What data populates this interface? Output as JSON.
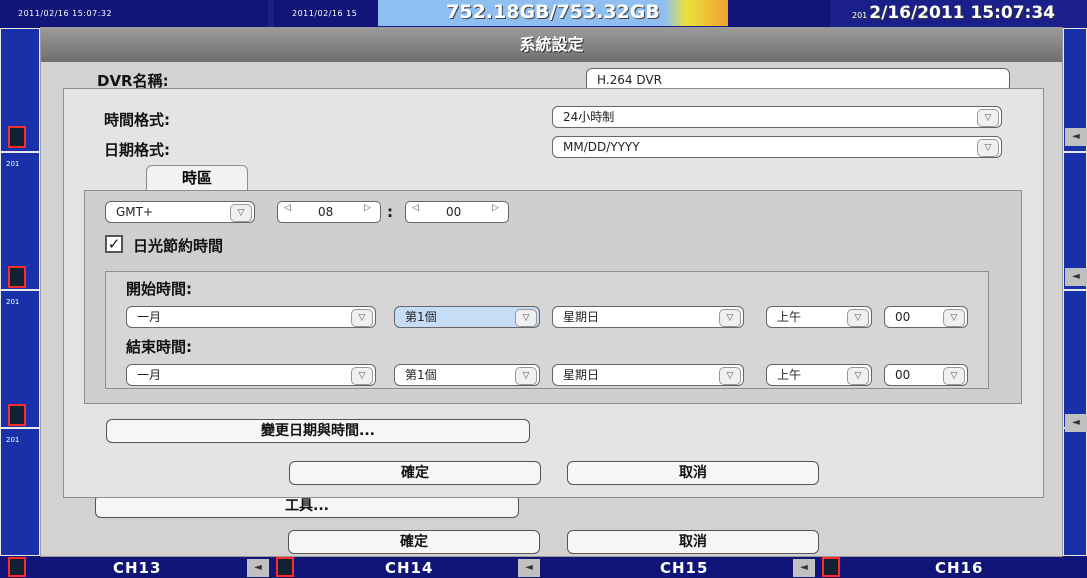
{
  "top_bar": {
    "cam1_time": "2011/02/16 15:07:32",
    "cam2_time": "2011/02/16 15",
    "hdd_usage": "752.18GB/753.32GB",
    "clock_prefix": "201",
    "clock": "2/16/2011 15:07:34"
  },
  "tiles": {
    "label": "201",
    "side_arrow": "◄"
  },
  "dialog": {
    "title": "系統設定",
    "dvr_name_label": "DVR名稱:",
    "dvr_name_value": "H.264 DVR",
    "time_format_label": "時間格式:",
    "time_format_value": "24小時制",
    "date_format_label": "日期格式:",
    "date_format_value": "MM/DD/YYYY",
    "timezone_tab": "時區",
    "gmt_value": "GMT+",
    "hour_value": "08",
    "minute_value": "00",
    "colon": ":",
    "dst_label": "日光節約時間",
    "dst_checked": "✓",
    "start_label": "開始時間:",
    "end_label": "結束時間:",
    "start": {
      "month": "一月",
      "week": "第1個",
      "day": "星期日",
      "ampm": "上午",
      "hour": "00"
    },
    "end": {
      "month": "一月",
      "week": "第1個",
      "day": "星期日",
      "ampm": "上午",
      "hour": "00"
    },
    "change_datetime_button": "變更日期與時間...",
    "ok_button": "確定",
    "cancel_button": "取消"
  },
  "background_dialog": {
    "tools_button": "工具...",
    "ok_button": "確定",
    "cancel_button": "取消"
  },
  "bottom_bar": {
    "ch13": "CH13",
    "ch14": "CH14",
    "ch15": "CH15",
    "ch16": "CH16"
  }
}
